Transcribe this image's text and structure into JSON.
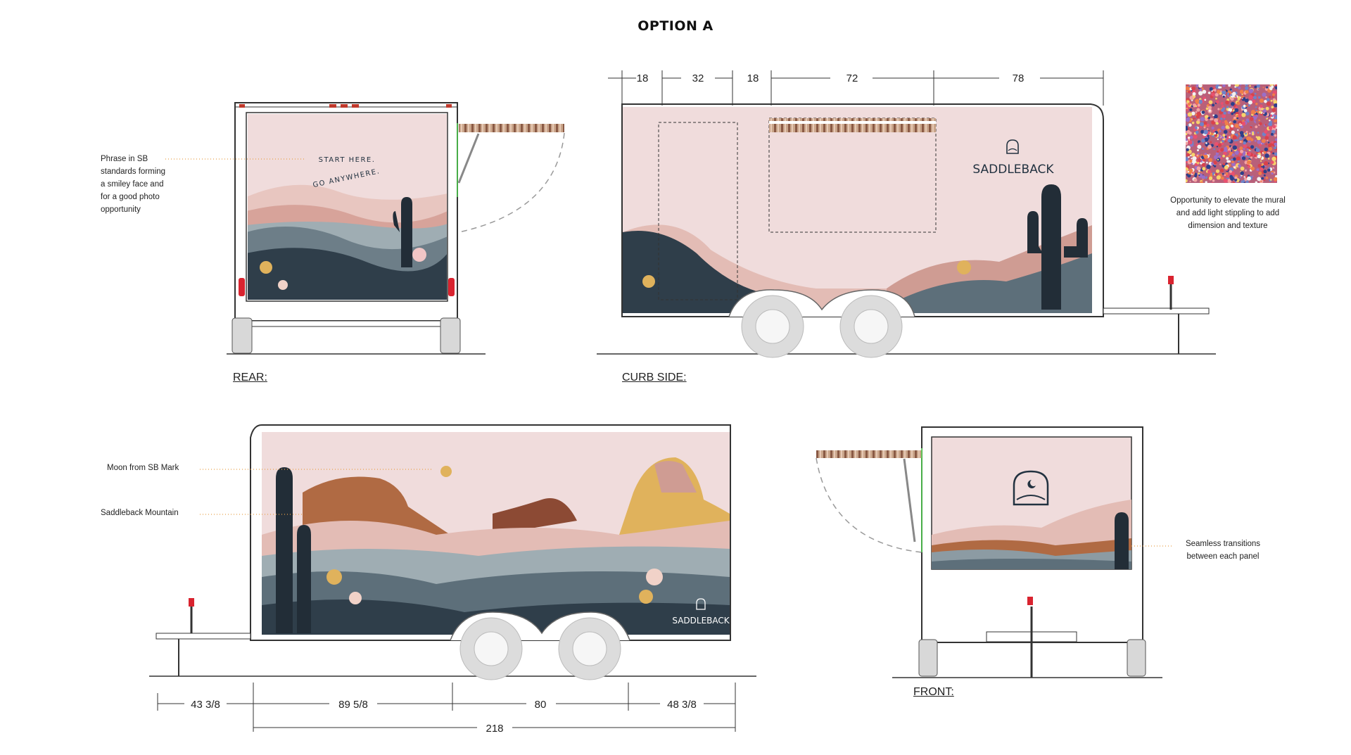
{
  "title": "OPTION A",
  "views": {
    "rear": "REAR:",
    "curb_side": "CURB SIDE:",
    "front": "FRONT:"
  },
  "notes": {
    "phrase": [
      "Phrase in SB",
      "standards forming",
      "a smiley face and",
      "for a good photo",
      "opportunity"
    ],
    "texture": [
      "Opportunity to elevate the mural",
      "and add light stippling to add",
      "dimension and texture"
    ],
    "moon": "Moon from SB Mark",
    "mountain": "Saddleback Mountain",
    "seamless": [
      "Seamless transitions",
      "between each panel"
    ]
  },
  "mural": {
    "phrase_line1": "START HERE.",
    "phrase_line2": "GO ANYWHERE.",
    "brand": "SADDLEBACK"
  },
  "dimensions": {
    "top": [
      "18",
      "32",
      "18",
      "72",
      "78"
    ],
    "bottom": [
      "43 3/8",
      "89 5/8",
      "80",
      "48 3/8"
    ],
    "total": "218"
  },
  "colors": {
    "sky": "#f0dcdc",
    "pink_hill": "#e3bcb5",
    "rose_hill": "#cf9c93",
    "grey_hill": "#8c9ba3",
    "slate_hill": "#5d6f7a",
    "dark_hill": "#2f3e4a",
    "cactus": "#222d37",
    "gold": "#e0b25c",
    "rust": "#b06a43",
    "note_line": "#e8a04a",
    "accent_green": "#4fd64f"
  }
}
